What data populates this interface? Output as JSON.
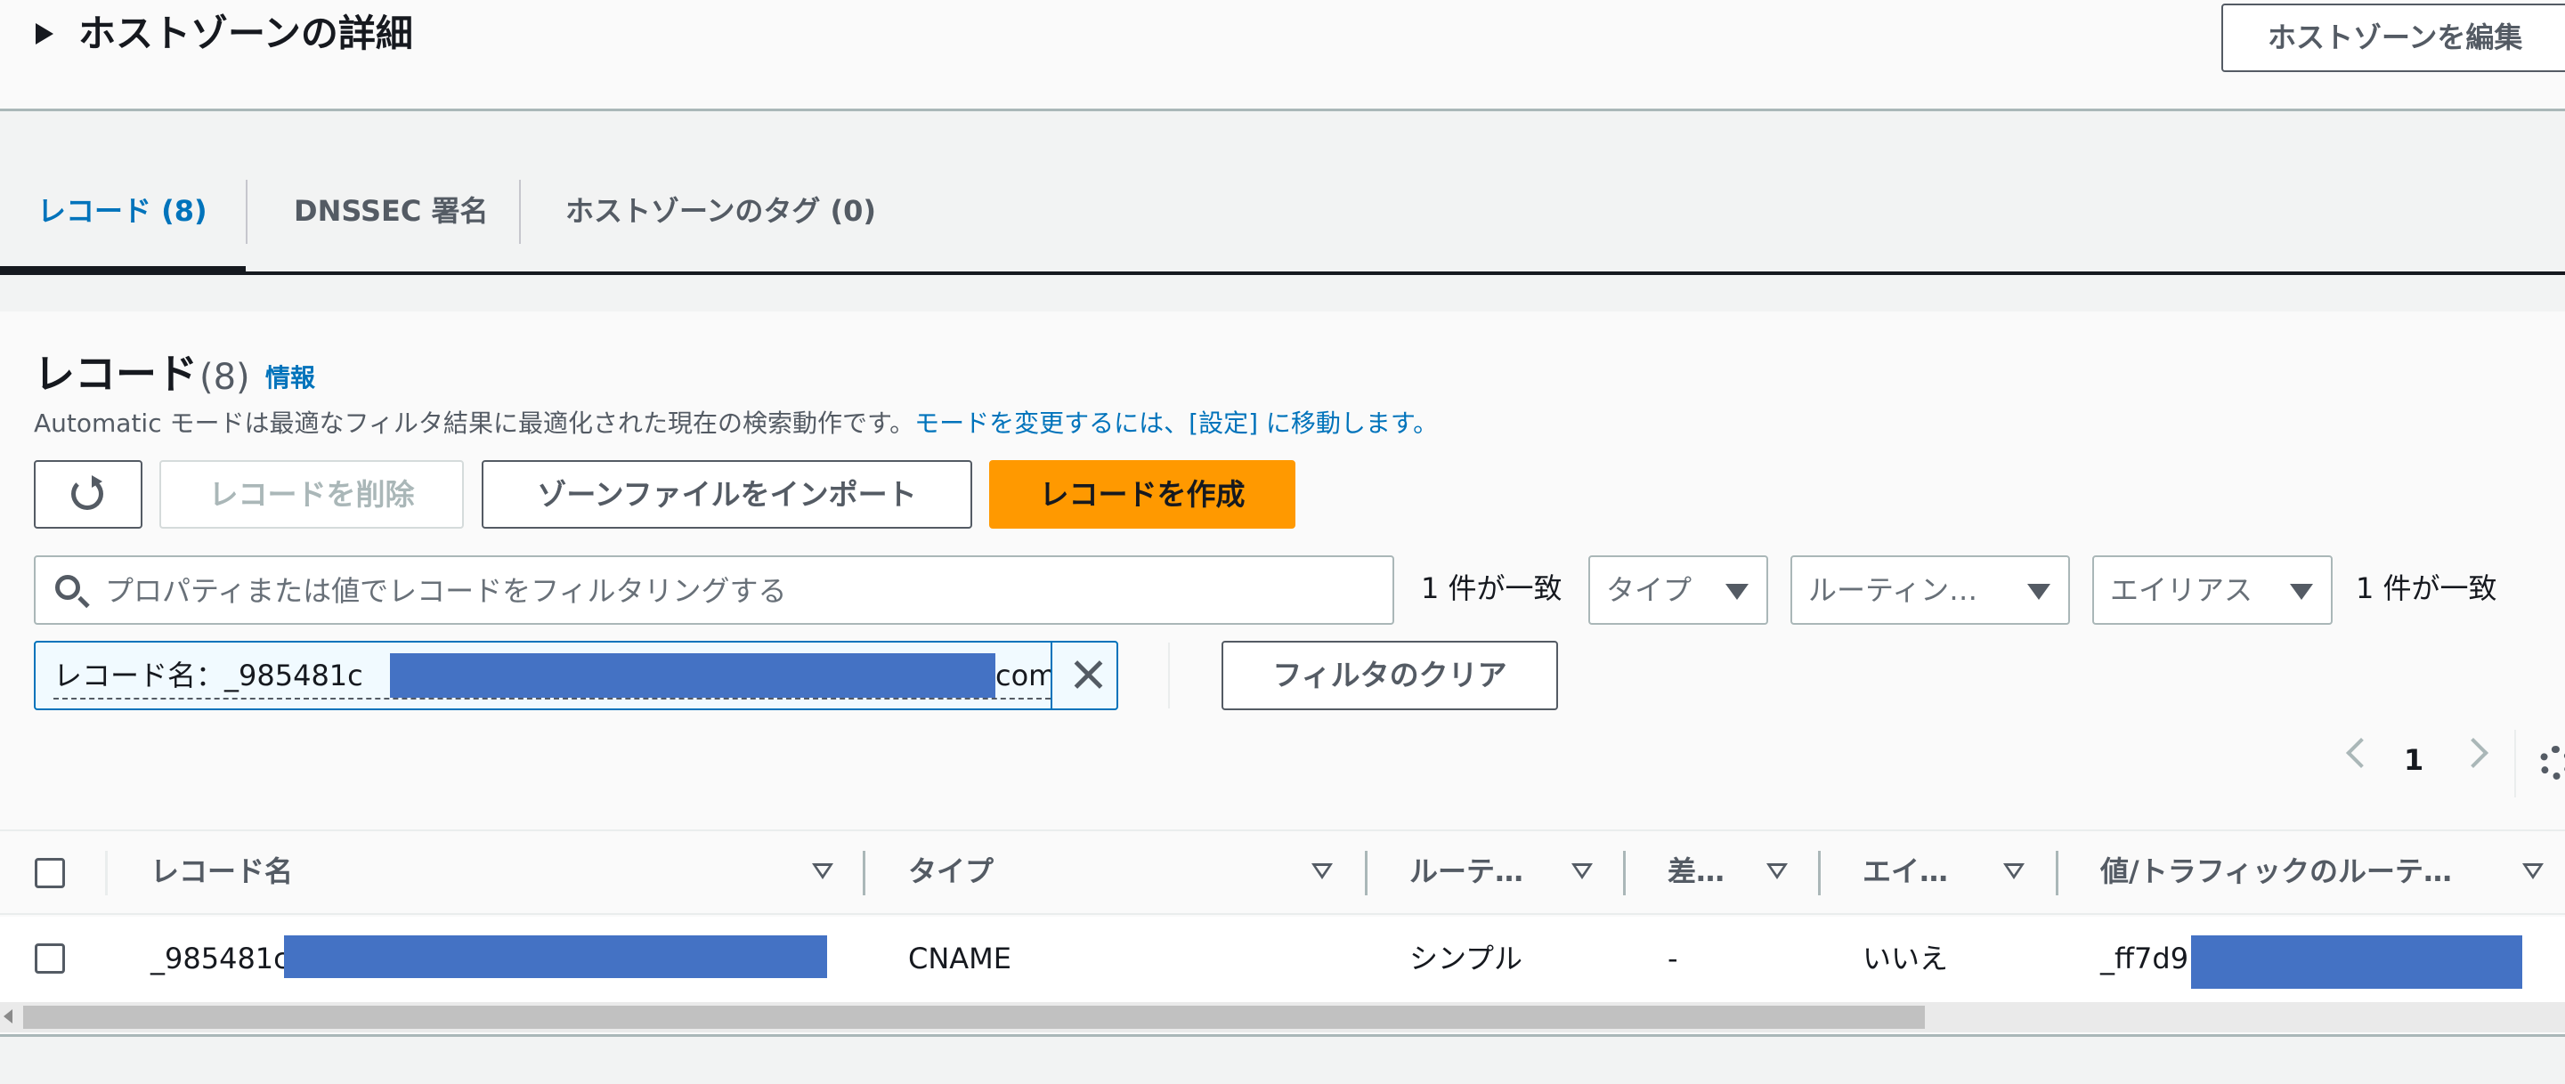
{
  "header": {
    "title": "ホストゾーンの詳細",
    "edit_button": "ホストゾーンを編集"
  },
  "tabs": [
    {
      "label": "レコード (8)",
      "active": true
    },
    {
      "label": "DNSSEC 署名",
      "active": false
    },
    {
      "label": "ホストゾーンのタグ (0)",
      "active": false
    }
  ],
  "records": {
    "title": "レコード",
    "count": "(8)",
    "info_link": "情報",
    "description": "Automatic モードは最適なフィルタ結果に最適化された現在の検索動作です。",
    "description_link": "モードを変更するには、[設定] に移動します。",
    "buttons": {
      "delete": "レコードを削除",
      "import": "ゾーンファイルをインポート",
      "create": "レコードを作成"
    },
    "search_placeholder": "プロパティまたは値でレコードをフィルタリングする",
    "match_count_1": "1 件が一致",
    "match_count_2": "1 件が一致",
    "filters": {
      "type": "タイプ",
      "routing": "ルーティン…",
      "alias": "エイリアス"
    },
    "token": {
      "prefix": "レコード名：_985481c",
      "suffix": "com"
    },
    "clear_filters": "フィルタのクリア",
    "page": "1"
  },
  "table": {
    "columns": [
      "レコード名",
      "タイプ",
      "ルーテ…",
      "差…",
      "エイ…",
      "値/トラフィックのルーテ…"
    ],
    "rows": [
      {
        "name": "_985481c",
        "type": "CNAME",
        "routing": "シンプル",
        "diff": "-",
        "alias": "いいえ",
        "value": "_ff7d9"
      }
    ]
  },
  "colors": {
    "accent": "#0073bb",
    "primary_button": "#ff9900",
    "redaction": "#4472c4"
  }
}
